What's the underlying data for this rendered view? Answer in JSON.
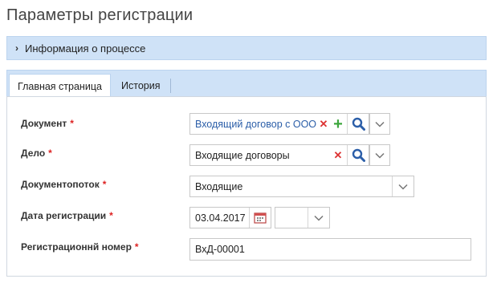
{
  "page": {
    "title": "Параметры регистрации"
  },
  "process_bar": {
    "label": "Информация о процессе"
  },
  "tabs": [
    {
      "label": "Главная страница",
      "active": true
    },
    {
      "label": "История",
      "active": false
    }
  ],
  "form": {
    "document": {
      "label": "Документ",
      "required": "*",
      "value": "Входящий договор с ООО \""
    },
    "case": {
      "label": "Дело",
      "required": "*",
      "value": "Входящие договоры"
    },
    "flow": {
      "label": "Документопоток",
      "required": "*",
      "value": "Входящие"
    },
    "reg_date": {
      "label": "Дата регистрации",
      "required": "*",
      "value": "03.04.2017",
      "time_value": ""
    },
    "reg_number": {
      "label": "Регистрационнй номер",
      "required": "*",
      "value": "ВхД-00001"
    }
  },
  "colors": {
    "accent_bg": "#cfe2f7",
    "required": "#dd2222",
    "link": "#2b5ea8",
    "add": "#3ea73e",
    "clear": "#dd3333"
  },
  "icons": {
    "expand": "chevron-right-icon",
    "add": "plus-icon",
    "search": "search-icon",
    "dropdown": "chevron-down-icon",
    "clear": "close-icon",
    "calendar": "calendar-icon"
  }
}
